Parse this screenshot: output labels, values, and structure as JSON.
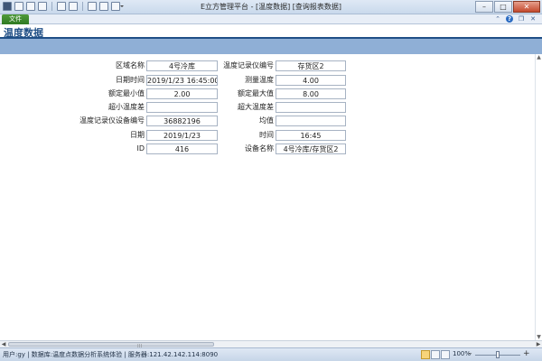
{
  "window": {
    "title": "E立方管理平台 - [温度数据] [查询报表数据]",
    "minimize_glyph": "–",
    "maximize_glyph": "□",
    "close_glyph": "✕"
  },
  "ribbon": {
    "file_tab": "文件",
    "icons": [
      "expand-ribbon-icon",
      "help-icon",
      "restore-icon",
      "close-doc-icon"
    ]
  },
  "page": {
    "title": "温度数据"
  },
  "form": {
    "left": [
      {
        "label": "区域名称",
        "value": "4号冷库"
      },
      {
        "label": "日期时间",
        "value": "2019/1/23 16:45:00"
      },
      {
        "label": "额定最小值",
        "value": "2.00"
      },
      {
        "label": "超小温度差",
        "value": ""
      },
      {
        "label": "温度记录仪设备编号",
        "value": "36882196"
      },
      {
        "label": "日期",
        "value": "2019/1/23"
      },
      {
        "label": "ID",
        "value": "416"
      }
    ],
    "right": [
      {
        "label": "温度记录仪编号",
        "value": "存货区2"
      },
      {
        "label": "测量温度",
        "value": "4.00"
      },
      {
        "label": "额定最大值",
        "value": "8.00"
      },
      {
        "label": "超大温度差",
        "value": ""
      },
      {
        "label": "均值",
        "value": ""
      },
      {
        "label": "时间",
        "value": "16:45"
      },
      {
        "label": "设备名称",
        "value": "4号冷库/存货区2"
      }
    ]
  },
  "statusbar": {
    "text": "用户:gy | 数据库:温度点数据分析系统体验 | 服务器:121.42.142.114:8090",
    "zoom": "100%",
    "zoom_minus": "–",
    "zoom_plus": "+"
  }
}
